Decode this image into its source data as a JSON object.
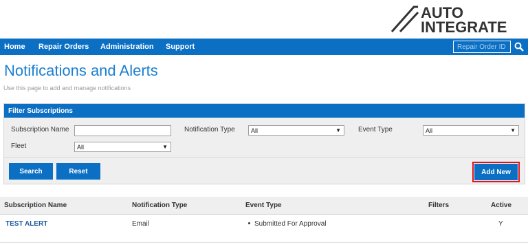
{
  "brand": {
    "logo_text": "AUTO INTEGRATE",
    "logo_line1": "AUTO",
    "logo_line2": "INTEGRATE"
  },
  "nav": {
    "items": [
      {
        "label": "Home"
      },
      {
        "label": "Repair Orders"
      },
      {
        "label": "Administration"
      },
      {
        "label": "Support"
      }
    ]
  },
  "search": {
    "placeholder": "Repair Order ID",
    "icon": "search-icon"
  },
  "page": {
    "title": "Notifications and Alerts",
    "subtitle": "Use this page to add and manage notifications"
  },
  "filter": {
    "header": "Filter Subscriptions",
    "subscription_name_label": "Subscription Name",
    "subscription_name_value": "",
    "notification_type_label": "Notification Type",
    "notification_type_value": "All",
    "event_type_label": "Event Type",
    "event_type_value": "All",
    "fleet_label": "Fleet",
    "fleet_value": "All",
    "search_button": "Search",
    "reset_button": "Reset",
    "add_new_button": "Add New"
  },
  "table": {
    "headers": [
      "Subscription Name",
      "Notification Type",
      "Event Type",
      "Filters",
      "Active"
    ],
    "rows": [
      {
        "subscription_name": "TEST ALERT",
        "notification_type": "Email",
        "event_type": "Submitted For Approval",
        "filters": "",
        "active": "Y"
      }
    ]
  },
  "colors": {
    "primary": "#0b6fc4",
    "title": "#1b7fd0",
    "highlight": "#e0141c"
  }
}
